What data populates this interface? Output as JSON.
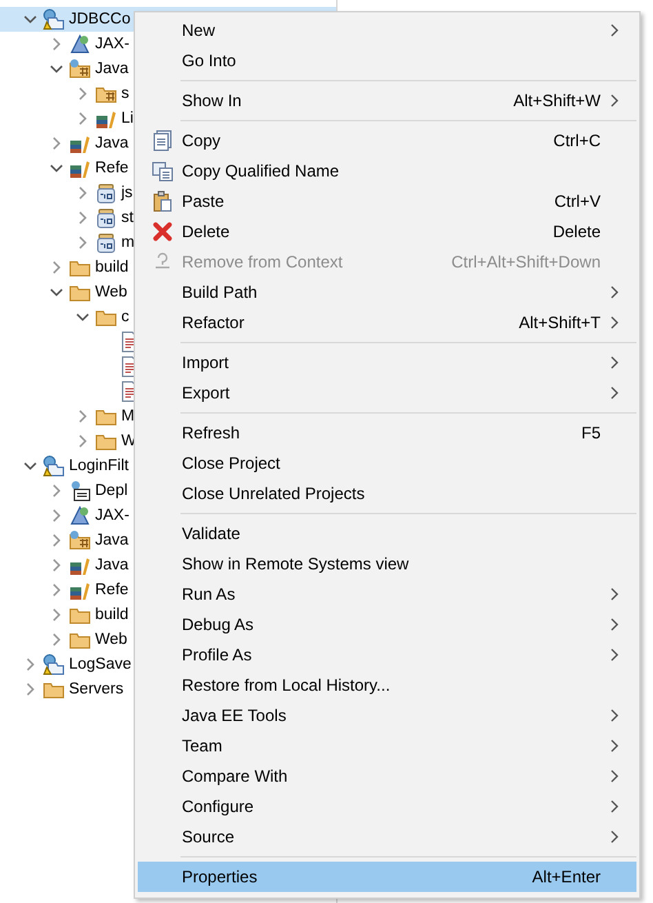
{
  "tree": [
    {
      "label": "JDBCCo",
      "kind": "project",
      "expanded": true,
      "selected": true,
      "children": [
        {
          "label": "JAX-",
          "kind": "webservice",
          "expanded": false,
          "selected": false
        },
        {
          "label": "Java",
          "kind": "java-resources",
          "expanded": true,
          "selected": false,
          "children": [
            {
              "label": "s",
              "kind": "source-folder",
              "expanded": false,
              "selected": false
            },
            {
              "label": "Li",
              "kind": "library",
              "expanded": false,
              "selected": false
            }
          ]
        },
        {
          "label": "Java",
          "kind": "library",
          "expanded": false,
          "selected": false
        },
        {
          "label": "Refe",
          "kind": "library",
          "expanded": true,
          "selected": false,
          "children": [
            {
              "label": "js",
              "kind": "jar",
              "expanded": false,
              "selected": false
            },
            {
              "label": "st",
              "kind": "jar",
              "expanded": false,
              "selected": false
            },
            {
              "label": "m",
              "kind": "jar",
              "expanded": false,
              "selected": false
            }
          ]
        },
        {
          "label": "build",
          "kind": "folder",
          "expanded": false,
          "selected": false
        },
        {
          "label": "Web",
          "kind": "folder",
          "expanded": true,
          "selected": false,
          "children": [
            {
              "label": "c",
              "kind": "folder",
              "expanded": true,
              "selected": false,
              "children": [
                {
                  "kind": "file",
                  "selected": false
                },
                {
                  "kind": "file",
                  "selected": false
                },
                {
                  "kind": "file",
                  "selected": false
                }
              ]
            },
            {
              "label": "M",
              "kind": "folder",
              "expanded": false,
              "selected": false
            },
            {
              "label": "W",
              "kind": "folder",
              "expanded": false,
              "selected": false
            }
          ]
        }
      ]
    },
    {
      "label": "LoginFilt",
      "kind": "project",
      "expanded": true,
      "selected": false,
      "children": [
        {
          "label": "Depl",
          "kind": "deploy",
          "expanded": false,
          "selected": false
        },
        {
          "label": "JAX-",
          "kind": "webservice",
          "expanded": false,
          "selected": false
        },
        {
          "label": "Java",
          "kind": "java-resources",
          "expanded": false,
          "selected": false
        },
        {
          "label": "Java",
          "kind": "library",
          "expanded": false,
          "selected": false
        },
        {
          "label": "Refe",
          "kind": "library",
          "expanded": false,
          "selected": false
        },
        {
          "label": "build",
          "kind": "folder",
          "expanded": false,
          "selected": false
        },
        {
          "label": "Web",
          "kind": "folder",
          "expanded": false,
          "selected": false
        }
      ]
    },
    {
      "label": "LogSave",
      "kind": "project",
      "expanded": false,
      "selected": false
    },
    {
      "label": "Servers",
      "kind": "folder",
      "expanded": false,
      "selected": false
    }
  ],
  "context_menu": [
    {
      "kind": "item",
      "label": "New",
      "submenu": true,
      "disabled": false,
      "selected": false
    },
    {
      "kind": "item",
      "label": "Go Into",
      "submenu": false,
      "disabled": false,
      "selected": false
    },
    {
      "kind": "separator"
    },
    {
      "kind": "item",
      "label": "Show In",
      "shortcut": "Alt+Shift+W",
      "submenu": true,
      "disabled": false,
      "selected": false
    },
    {
      "kind": "separator"
    },
    {
      "kind": "copy",
      "label": "Copy",
      "shortcut": "Ctrl+C",
      "submenu": false,
      "disabled": false,
      "selected": false
    },
    {
      "kind": "copy-name",
      "label": "Copy Qualified Name",
      "submenu": false,
      "disabled": false,
      "selected": false
    },
    {
      "kind": "paste",
      "label": "Paste",
      "shortcut": "Ctrl+V",
      "submenu": false,
      "disabled": false,
      "selected": false
    },
    {
      "kind": "delete",
      "label": "Delete",
      "shortcut": "Delete",
      "submenu": false,
      "disabled": false,
      "selected": false
    },
    {
      "kind": "remove",
      "label": "Remove from Context",
      "shortcut": "Ctrl+Alt+Shift+Down",
      "submenu": false,
      "disabled": true,
      "selected": false
    },
    {
      "kind": "item",
      "label": "Build Path",
      "submenu": true,
      "disabled": false,
      "selected": false
    },
    {
      "kind": "item",
      "label": "Refactor",
      "shortcut": "Alt+Shift+T",
      "submenu": true,
      "disabled": false,
      "selected": false
    },
    {
      "kind": "separator"
    },
    {
      "kind": "item",
      "label": "Import",
      "submenu": true,
      "disabled": false,
      "selected": false
    },
    {
      "kind": "item",
      "label": "Export",
      "submenu": true,
      "disabled": false,
      "selected": false
    },
    {
      "kind": "separator"
    },
    {
      "kind": "item",
      "label": "Refresh",
      "shortcut": "F5",
      "submenu": false,
      "disabled": false,
      "selected": false
    },
    {
      "kind": "item",
      "label": "Close Project",
      "submenu": false,
      "disabled": false,
      "selected": false
    },
    {
      "kind": "item",
      "label": "Close Unrelated Projects",
      "submenu": false,
      "disabled": false,
      "selected": false
    },
    {
      "kind": "separator"
    },
    {
      "kind": "item",
      "label": "Validate",
      "submenu": false,
      "disabled": false,
      "selected": false
    },
    {
      "kind": "item",
      "label": "Show in Remote Systems view",
      "submenu": false,
      "disabled": false,
      "selected": false
    },
    {
      "kind": "item",
      "label": "Run As",
      "submenu": true,
      "disabled": false,
      "selected": false
    },
    {
      "kind": "item",
      "label": "Debug As",
      "submenu": true,
      "disabled": false,
      "selected": false
    },
    {
      "kind": "item",
      "label": "Profile As",
      "submenu": true,
      "disabled": false,
      "selected": false
    },
    {
      "kind": "item",
      "label": "Restore from Local History...",
      "submenu": false,
      "disabled": false,
      "selected": false
    },
    {
      "kind": "item",
      "label": "Java EE Tools",
      "submenu": true,
      "disabled": false,
      "selected": false
    },
    {
      "kind": "item",
      "label": "Team",
      "submenu": true,
      "disabled": false,
      "selected": false
    },
    {
      "kind": "item",
      "label": "Compare With",
      "submenu": true,
      "disabled": false,
      "selected": false
    },
    {
      "kind": "item",
      "label": "Configure",
      "submenu": true,
      "disabled": false,
      "selected": false
    },
    {
      "kind": "item",
      "label": "Source",
      "submenu": true,
      "disabled": false,
      "selected": false
    },
    {
      "kind": "separator"
    },
    {
      "kind": "item",
      "label": "Properties",
      "shortcut": "Alt+Enter",
      "submenu": false,
      "disabled": false,
      "selected": true
    }
  ]
}
